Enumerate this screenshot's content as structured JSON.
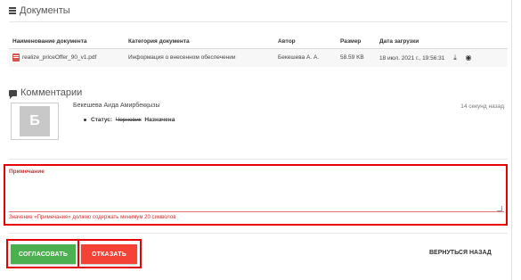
{
  "documents": {
    "title": "Документы",
    "columns": [
      "Наименование документа",
      "Категория документа",
      "Автор",
      "Размер",
      "Дата загрузки"
    ],
    "rows": [
      {
        "name": "realize_priceOffer_90_v1.pdf",
        "category": "Информация о внесенном обеспечении",
        "author": "Бекешева А. А.",
        "size": "58.59 KB",
        "date": "18 июл. 2021 г., 19:56:31"
      }
    ]
  },
  "comments": {
    "title": "Комментарии",
    "items": [
      {
        "avatar_letter": "Б",
        "author": "Бекешева Аида Амирбекқызы",
        "time": "14 секунд назад",
        "status_label": "Статус:",
        "status_old": "Черновик",
        "status_new": "Назначена"
      }
    ]
  },
  "note": {
    "label": "Примечание",
    "value": "",
    "error": "Значение «Примечание» должно содержать минимум 20 символов"
  },
  "actions": {
    "agree": "СОГЛАСОВАТЬ",
    "refuse": "ОТКАЗАТЬ",
    "back": "ВЕРНУТЬСЯ НАЗАД"
  },
  "colors": {
    "agree": "#4caf50",
    "refuse": "#f44336",
    "highlight": "#e60000",
    "error": "#d32f2f"
  },
  "icons": {
    "documents": "list-icon",
    "comments": "comment-icon",
    "file": "pdf-file-icon",
    "download": "download-icon",
    "view": "eye-icon"
  }
}
